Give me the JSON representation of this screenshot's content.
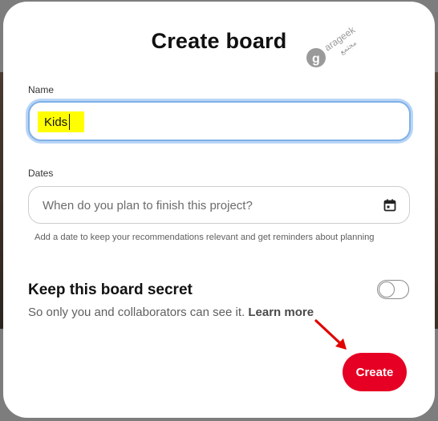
{
  "dialog": {
    "title": "Create board"
  },
  "name_field": {
    "label": "Name",
    "value": "Kids"
  },
  "dates_field": {
    "label": "Dates",
    "placeholder": "When do you plan to finish this project?",
    "helper": "Add a date to keep your recommendations relevant and get reminders about planning",
    "icon": "calendar-icon"
  },
  "secret": {
    "title": "Keep this board secret",
    "description": "So only you and collaborators can see it.",
    "learn_more": "Learn more",
    "enabled": false
  },
  "actions": {
    "create_label": "Create"
  },
  "watermark": {
    "text": "arageek",
    "subtext": "مجتمع"
  },
  "colors": {
    "primary": "#e60023",
    "focus_ring": "#7fb0e8",
    "highlight": "#ffff00",
    "annotation_arrow": "#e00000"
  }
}
